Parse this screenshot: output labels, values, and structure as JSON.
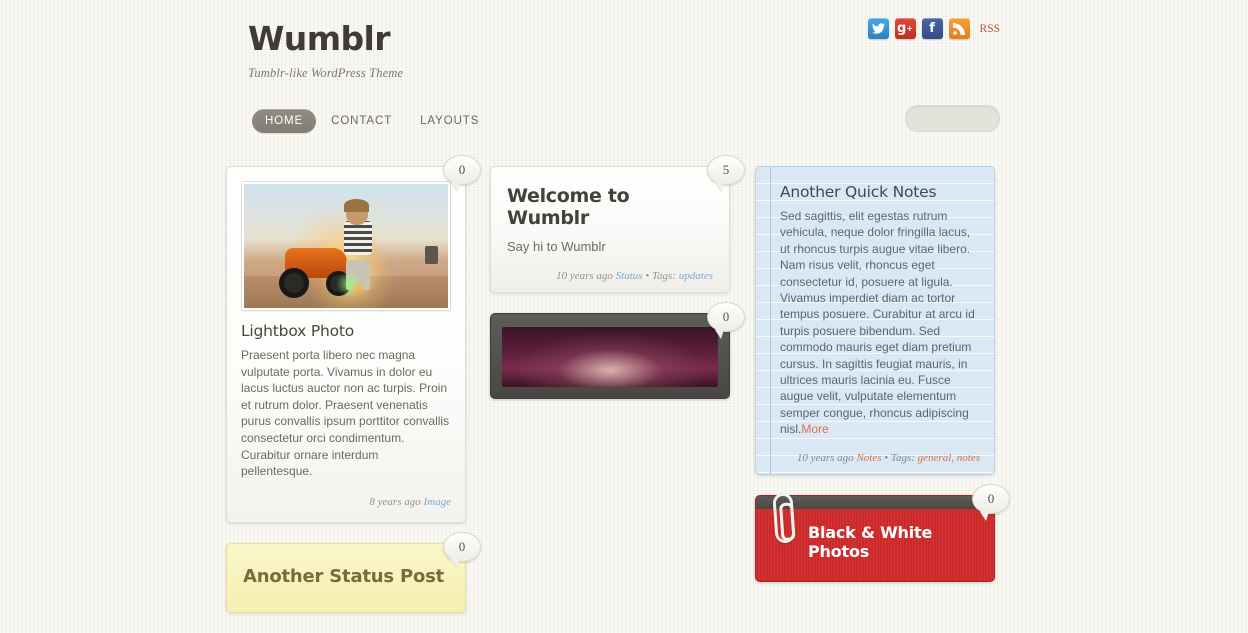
{
  "site": {
    "title": "Wumblr",
    "tagline": "Tumblr-like WordPress Theme"
  },
  "social": [
    {
      "name": "twitter",
      "glyph": "🐦",
      "label": ""
    },
    {
      "name": "google-plus",
      "glyph": "g+",
      "label": ""
    },
    {
      "name": "facebook",
      "glyph": "f",
      "label": ""
    },
    {
      "name": "rss",
      "glyph": "◔",
      "label": "RSS"
    }
  ],
  "nav": {
    "items": [
      {
        "label": "HOME",
        "active": true
      },
      {
        "label": "CONTACT",
        "active": false
      },
      {
        "label": "LAYOUTS",
        "active": false
      }
    ]
  },
  "search": {
    "value": "",
    "placeholder": ""
  },
  "posts": {
    "lightbox_photo": {
      "comments": "0",
      "title": "Lightbox Photo",
      "body": "Praesent porta libero nec magna vulputate porta. Vivamus in dolor eu lacus luctus auctor non ac turpis. Proin et rutrum dolor. Praesent venenatis purus convallis ipsum porttitor convallis consectetur orci condimentum. Curabitur ornare interdum pellentesque.",
      "meta_time": "8 years ago",
      "meta_category": "Image"
    },
    "welcome": {
      "comments": "5",
      "title": "Welcome to Wumblr",
      "subtitle": "Say hi to Wumblr",
      "meta_time": "10 years ago",
      "meta_category": "Status",
      "meta_sep": "•",
      "meta_tags_label": "Tags:",
      "meta_tags": "updates"
    },
    "quick_notes": {
      "title": "Another Quick Notes",
      "body": "Sed sagittis, elit egestas rutrum vehicula, neque dolor fringilla lacus, ut rhoncus turpis augue vitae libero. Nam risus velit, rhoncus eget consectetur id, posuere at ligula. Vivamus imperdiet diam ac tortor tempus posuere. Curabitur at arcu id turpis posuere bibendum. Sed commodo mauris eget diam pretium cursus. In sagittis feugiat mauris, in ultrices mauris lacinia eu. Fusce augue velit, vulputate elementum semper congue, rhoncus adipiscing nisl.",
      "more_label": "More",
      "meta_time": "10 years ago",
      "meta_category": "Notes",
      "meta_sep": "•",
      "meta_tags_label": "Tags:",
      "meta_tags": "general, notes"
    },
    "another_status": {
      "comments": "0",
      "title": "Another Status Post"
    },
    "video_post": {
      "comments": "0"
    },
    "bw_photos": {
      "comments": "0",
      "title": "Black & White Photos"
    }
  }
}
